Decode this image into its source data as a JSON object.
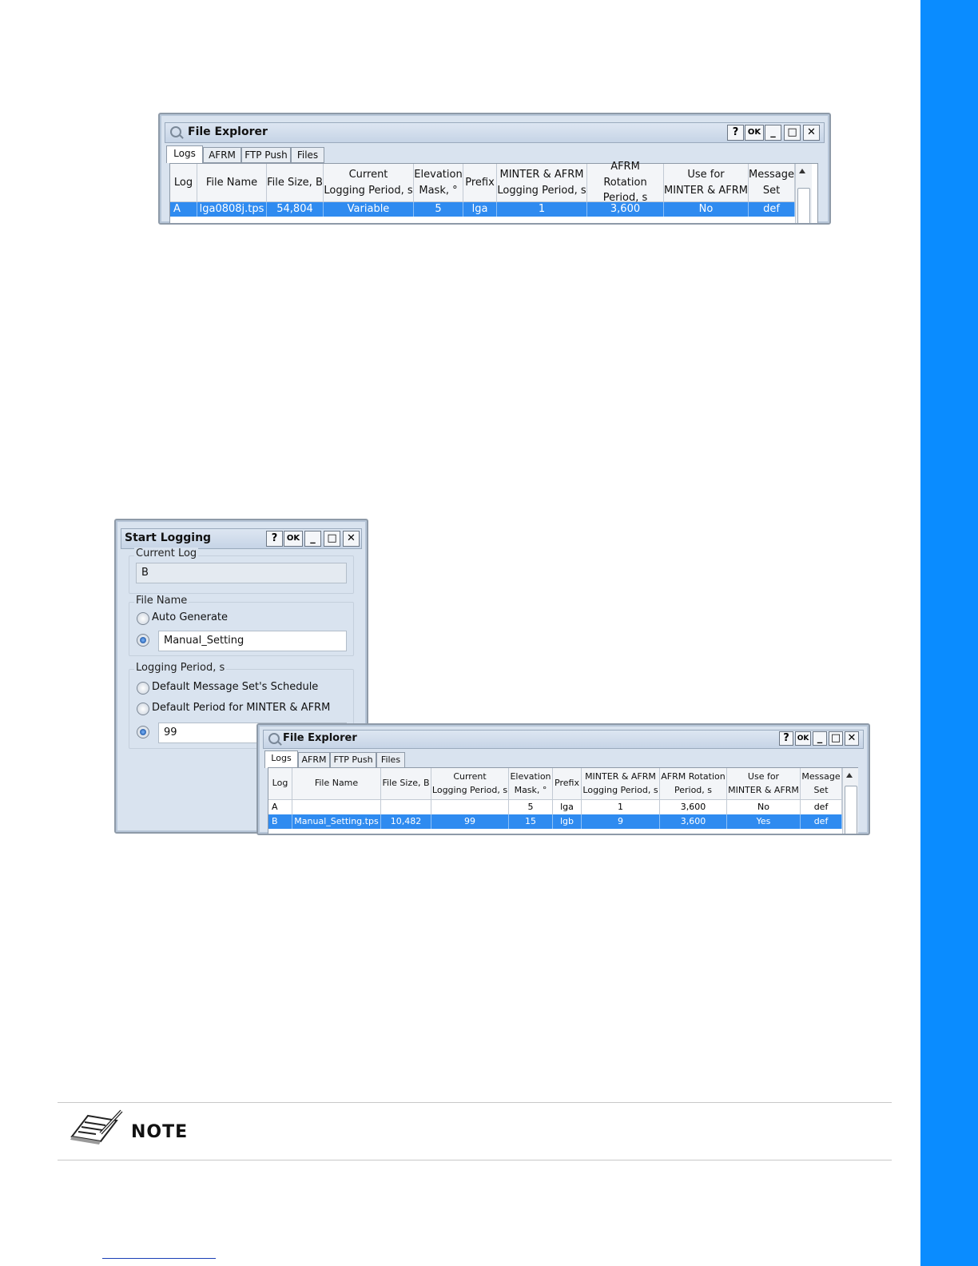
{
  "explorer1": {
    "title": "File Explorer",
    "buttons": {
      "help": "?",
      "ok": "OK"
    },
    "tabs": [
      "Logs",
      "AFRM",
      "FTP Push",
      "Files"
    ],
    "headers": [
      "Log",
      "File Name",
      "File Size, B",
      "Current\nLogging Period, s",
      "Elevation\nMask, °",
      "Prefix",
      "MINTER & AFRM\nLogging Period, s",
      "AFRM Rotation\nPeriod, s",
      "Use for\nMINTER & AFRM",
      "Message\nSet"
    ],
    "rows": [
      {
        "selected": true,
        "cells": [
          "A",
          "lga0808j.tps",
          "54,804",
          "Variable",
          "5",
          "lga",
          "1",
          "3,600",
          "No",
          "def"
        ]
      }
    ]
  },
  "start_logging": {
    "title": "Start Logging",
    "buttons": {
      "help": "?",
      "ok": "OK"
    },
    "current_log_label": "Current Log",
    "current_log_value": "B",
    "file_name_label": "File Name",
    "auto_generate": "Auto Generate",
    "manual_value": "Manual_Setting",
    "period_label": "Logging Period, s",
    "option_default_msg": "Default Message Set's Schedule",
    "option_default_minter": "Default Period for MINTER & AFRM",
    "period_value": "99"
  },
  "explorer2": {
    "title": "File Explorer",
    "buttons": {
      "help": "?",
      "ok": "OK"
    },
    "tabs": [
      "Logs",
      "AFRM",
      "FTP Push",
      "Files"
    ],
    "headers": [
      "Log",
      "File Name",
      "File Size, B",
      "Current\nLogging Period, s",
      "Elevation\nMask, °",
      "Prefix",
      "MINTER & AFRM\nLogging Period, s",
      "AFRM Rotation\nPeriod, s",
      "Use for\nMINTER & AFRM",
      "Message\nSet"
    ],
    "rows": [
      {
        "selected": false,
        "cells": [
          "A",
          "",
          "",
          "",
          "5",
          "lga",
          "1",
          "3,600",
          "No",
          "def"
        ]
      },
      {
        "selected": true,
        "cells": [
          "B",
          "Manual_Setting.tps",
          "10,482",
          "99",
          "15",
          "lgb",
          "9",
          "3,600",
          "Yes",
          "def"
        ]
      }
    ]
  },
  "note": {
    "label": "NOTE"
  },
  "colors": {
    "sidebar": "#0a8cff",
    "selection": "#2f8bf0"
  }
}
